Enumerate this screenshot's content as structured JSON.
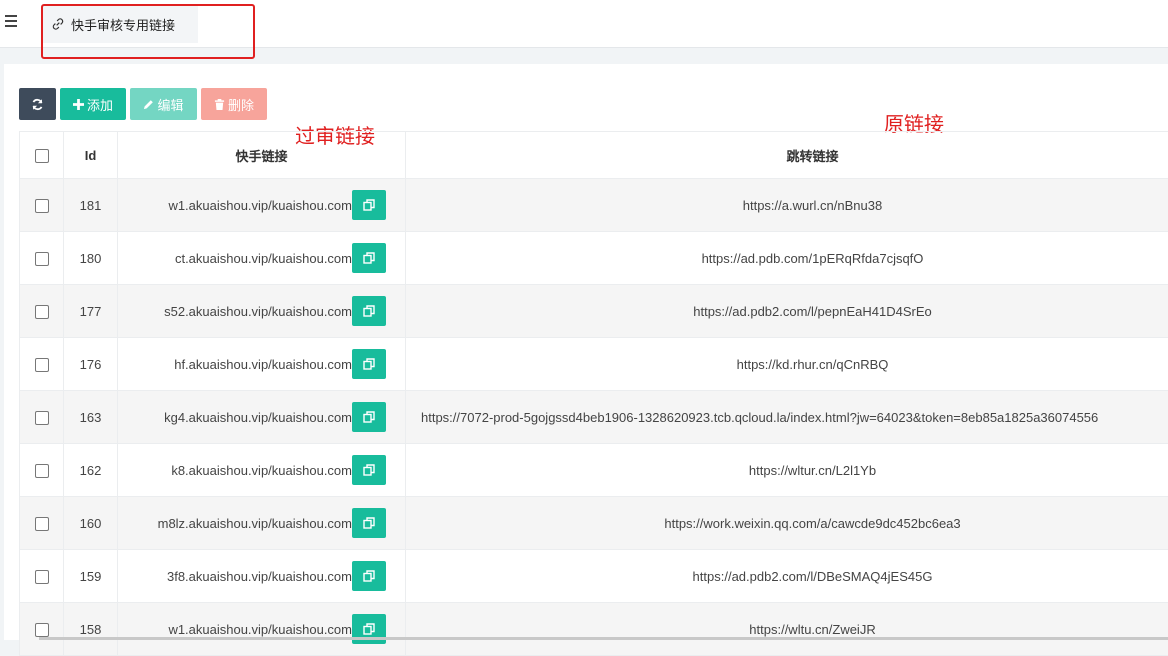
{
  "header": {
    "tab_title": "快手审核专用链接"
  },
  "toolbar": {
    "add_label": "添加",
    "edit_label": "编辑",
    "delete_label": "删除"
  },
  "annotations": {
    "left": "过审链接",
    "right": "原链接"
  },
  "table": {
    "columns": [
      "Id",
      "快手链接",
      "跳转链接"
    ],
    "rows": [
      {
        "id": "181",
        "kuaishou_link": "w1.akuaishou.vip/kuaishou.com",
        "redirect_link": "https://a.wurl.cn/nBnu38"
      },
      {
        "id": "180",
        "kuaishou_link": "ct.akuaishou.vip/kuaishou.com",
        "redirect_link": "https://ad.pdb.com/1pERqRfda7cjsqfO"
      },
      {
        "id": "177",
        "kuaishou_link": "s52.akuaishou.vip/kuaishou.com",
        "redirect_link": "https://ad.pdb2.com/l/pepnEaH41D4SrEo"
      },
      {
        "id": "176",
        "kuaishou_link": "hf.akuaishou.vip/kuaishou.com",
        "redirect_link": "https://kd.rhur.cn/qCnRBQ"
      },
      {
        "id": "163",
        "kuaishou_link": "kg4.akuaishou.vip/kuaishou.com",
        "redirect_link": "https://7072-prod-5gojgssd4beb1906-1328620923.tcb.qcloud.la/index.html?jw=64023&token=8eb85a1825a36074556"
      },
      {
        "id": "162",
        "kuaishou_link": "k8.akuaishou.vip/kuaishou.com",
        "redirect_link": "https://wltur.cn/L2l1Yb"
      },
      {
        "id": "160",
        "kuaishou_link": "m8lz.akuaishou.vip/kuaishou.com",
        "redirect_link": "https://work.weixin.qq.com/a/cawcde9dc452bc6ea3"
      },
      {
        "id": "159",
        "kuaishou_link": "3f8.akuaishou.vip/kuaishou.com",
        "redirect_link": "https://ad.pdb2.com/l/DBeSMAQ4jES45G"
      },
      {
        "id": "158",
        "kuaishou_link": "w1.akuaishou.vip/kuaishou.com",
        "redirect_link": "https://wltu.cn/ZweiJR"
      }
    ]
  },
  "icons": {
    "menu": "hamburger-icon",
    "tab": "link-icon",
    "refresh": "refresh-icon",
    "add": "plus-icon",
    "edit": "pencil-icon",
    "delete": "trash-icon",
    "copy": "copy-icon"
  },
  "colors": {
    "primary_green": "#18bc9c",
    "dark_button": "#3e4b5b",
    "annotation_red": "#e02020"
  }
}
